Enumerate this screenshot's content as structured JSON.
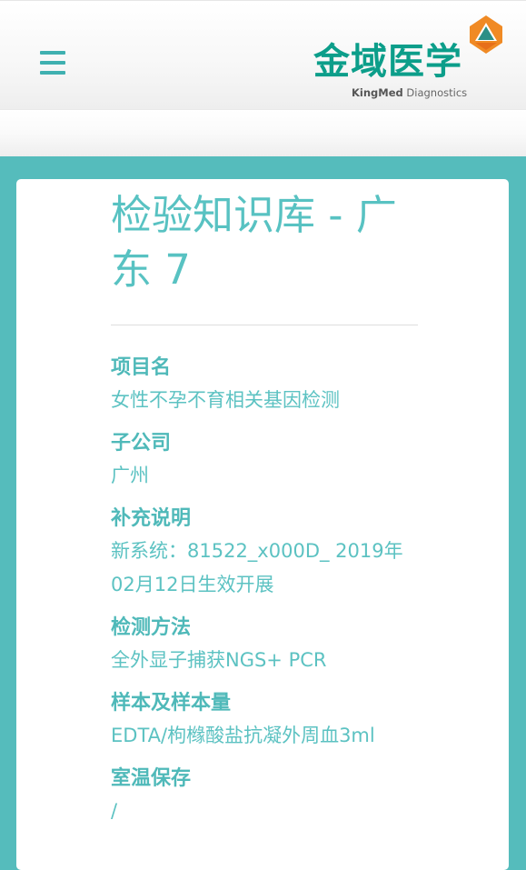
{
  "header": {
    "logo_cn": "金域医学",
    "logo_en_brand": "KingMed",
    "logo_en_rest": " Diagnostics",
    "menu_icon": "hamburger-menu-icon"
  },
  "colors": {
    "teal": "#55bcbc",
    "logo_green": "#0c9e8a",
    "orange": "#f08a24"
  },
  "page": {
    "title": "检验知识库 - 广东 7"
  },
  "fields": [
    {
      "label": "项目名",
      "value": "女性不孕不育相关基因检测"
    },
    {
      "label": "子公司",
      "value": "广州"
    },
    {
      "label": "补充说明",
      "value": "新系统：81522_x000D_ 2019年02月12日生效开展"
    },
    {
      "label": "检测方法",
      "value": "全外显子捕获NGS+ PCR"
    },
    {
      "label": "样本及样本量",
      "value": "EDTA/枸橼酸盐抗凝外周血3ml"
    },
    {
      "label": "室温保存",
      "value": "/"
    }
  ]
}
